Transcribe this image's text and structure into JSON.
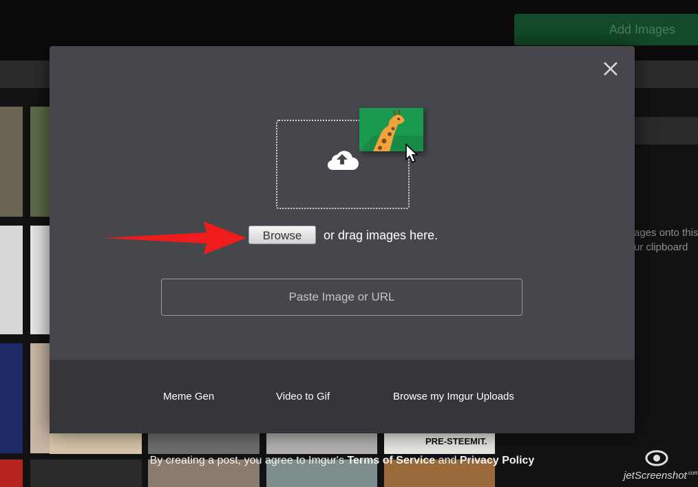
{
  "header": {
    "add_images_label": "Add Images"
  },
  "background": {
    "right_text_line1": "ages onto this",
    "right_text_line2": "ur clipboard",
    "legal_prefix": "By creating a post, you agree to Imgur's",
    "terms_label": "Terms of Service",
    "legal_and": "and",
    "privacy_label": "Privacy Policy",
    "tile_caption": "PRE-STEEMIT."
  },
  "modal": {
    "browse_label": "Browse",
    "drag_text": "or drag images here.",
    "paste_placeholder": "Paste Image or URL",
    "footer_links": [
      "Meme Gen",
      "Video to Gif",
      "Browse my Imgur Uploads"
    ]
  },
  "watermark": {
    "text": "jetScreenshot",
    "suffix": ".com"
  },
  "colors": {
    "modal_bg": "#45474d",
    "modal_footer_bg": "#35363a",
    "accent_green": "#1a9a4e",
    "arrow_red": "#ee1c1c"
  },
  "icons": [
    "close-icon",
    "cloud-upload-icon",
    "giraffe-image-icon",
    "cursor-icon",
    "red-arrow-icon"
  ]
}
